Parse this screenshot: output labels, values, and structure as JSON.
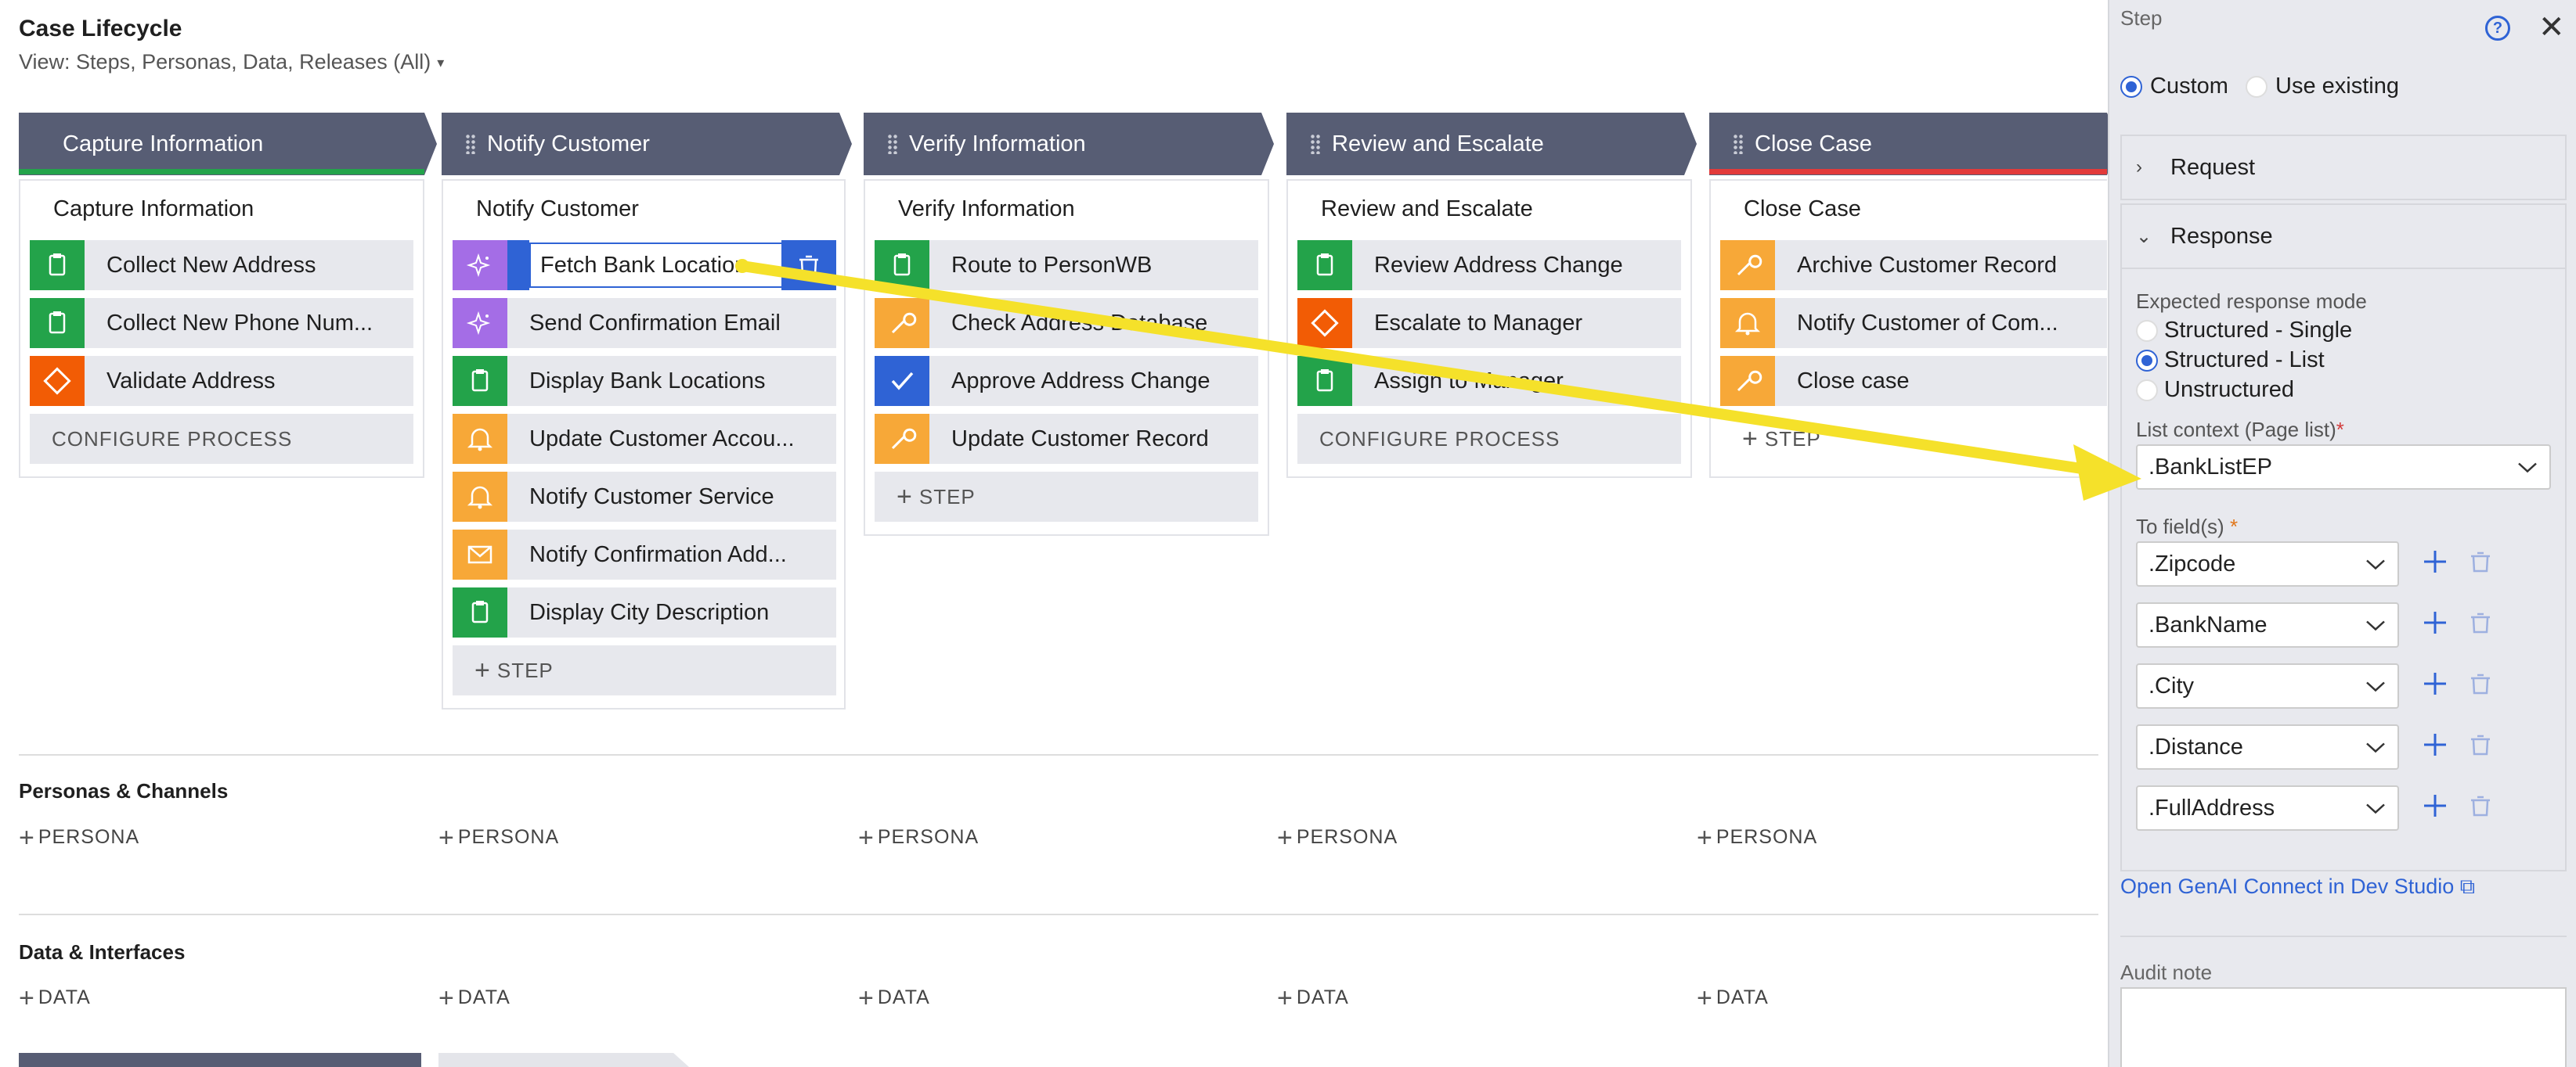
{
  "header": {
    "title": "Case Lifecycle",
    "view_label": "View: Steps, Personas, Data, Releases (All)"
  },
  "stages": [
    {
      "label": "Capture Information",
      "bar_color": "#23a34a"
    },
    {
      "label": "Notify Customer",
      "bar_color": ""
    },
    {
      "label": "Verify Information",
      "bar_color": ""
    },
    {
      "label": "Review and Escalate",
      "bar_color": ""
    },
    {
      "label": "Close Case",
      "bar_color": "#e23a3a"
    }
  ],
  "processes": [
    {
      "title": "Capture Information",
      "steps": [
        {
          "label": "Collect New Address",
          "icon": "clipboard-icon",
          "color": "green"
        },
        {
          "label": "Collect New Phone Num...",
          "icon": "clipboard-icon",
          "color": "green"
        },
        {
          "label": "Validate Address",
          "icon": "diamond-icon",
          "color": "red"
        }
      ],
      "footer": "CONFIGURE PROCESS"
    },
    {
      "title": "Notify Customer",
      "steps": [
        {
          "label": "Fetch Bank Location",
          "icon": "sparkle-icon",
          "color": "purple",
          "editing": true
        },
        {
          "label": "Send Confirmation Email",
          "icon": "sparkle-icon",
          "color": "purple"
        },
        {
          "label": "Display Bank Locations",
          "icon": "clipboard-icon",
          "color": "green"
        },
        {
          "label": "Update Customer Accou...",
          "icon": "bell-icon",
          "color": "orange"
        },
        {
          "label": "Notify Customer Service",
          "icon": "bell-icon",
          "color": "orange"
        },
        {
          "label": "Notify Confirmation Add...",
          "icon": "envelope-icon",
          "color": "orange"
        },
        {
          "label": "Display City Description",
          "icon": "clipboard-icon",
          "color": "green"
        }
      ],
      "footer": "STEP"
    },
    {
      "title": "Verify Information",
      "steps": [
        {
          "label": "Route to PersonWB",
          "icon": "clipboard-icon",
          "color": "green"
        },
        {
          "label": "Check Address Database",
          "icon": "wrench-icon",
          "color": "orange"
        },
        {
          "label": "Approve Address Change",
          "icon": "check-icon",
          "color": "blue"
        },
        {
          "label": "Update Customer Record",
          "icon": "wrench-icon",
          "color": "orange"
        }
      ],
      "footer": "STEP"
    },
    {
      "title": "Review and Escalate",
      "steps": [
        {
          "label": "Review Address Change",
          "icon": "clipboard-icon",
          "color": "green"
        },
        {
          "label": "Escalate to Manager",
          "icon": "diamond-icon",
          "color": "red"
        },
        {
          "label": "Assign to Manager",
          "icon": "clipboard-icon",
          "color": "green"
        }
      ],
      "footer": "CONFIGURE PROCESS"
    },
    {
      "title": "Close Case",
      "steps": [
        {
          "label": "Archive Customer Record",
          "icon": "wrench-icon",
          "color": "orange"
        },
        {
          "label": "Notify Customer of Com...",
          "icon": "bell-icon",
          "color": "orange"
        },
        {
          "label": "Close case",
          "icon": "wrench-icon",
          "color": "orange"
        }
      ],
      "footer": "STEP"
    }
  ],
  "personas": {
    "title": "Personas & Channels",
    "add_label": "PERSONA"
  },
  "data_section": {
    "title": "Data & Interfaces",
    "add_label": "DATA"
  },
  "panel": {
    "title": "Step",
    "radio_custom": "Custom",
    "radio_existing": "Use existing",
    "request_label": "Request",
    "response_label": "Response",
    "expected_mode_label": "Expected response mode",
    "mode_options": [
      "Structured - Single",
      "Structured - List",
      "Unstructured"
    ],
    "mode_selected": "Structured - List",
    "list_context_label": "List context (Page list)",
    "list_context_value": ".BankListEP",
    "to_fields_label": "To field(s)",
    "to_fields": [
      ".Zipcode",
      ".BankName",
      ".City",
      ".Distance",
      ".FullAddress"
    ],
    "gen_link": "Open GenAI Connect in Dev Studio",
    "audit_label": "Audit note"
  },
  "colors": {
    "accent": "#2f63d5",
    "stage_bg": "#575d74",
    "highlight_arrow": "#f5e12a"
  }
}
